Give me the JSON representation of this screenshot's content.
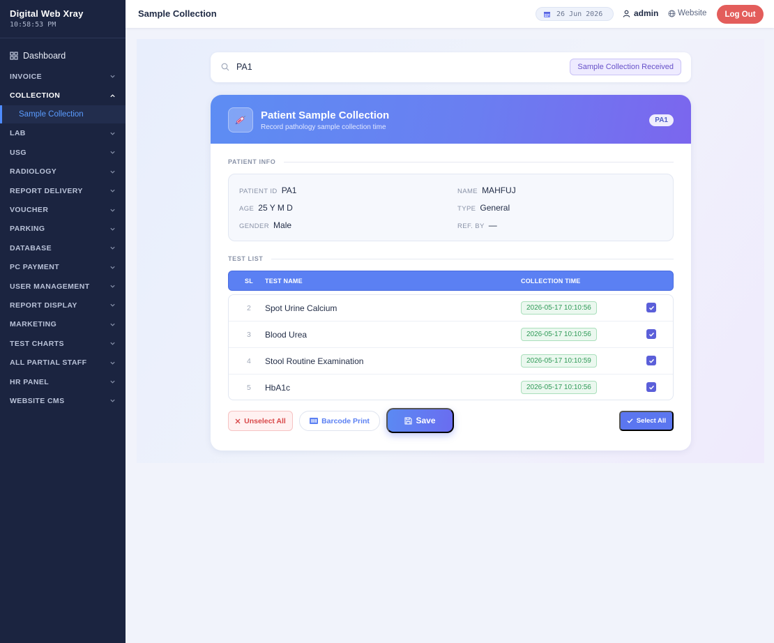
{
  "sidebar": {
    "brand": "Digital Web Xray",
    "clock": "10:58:53 PM",
    "dashboard": "Dashboard",
    "items": [
      {
        "label": "INVOICE"
      },
      {
        "label": "COLLECTION"
      },
      {
        "label": "LAB"
      },
      {
        "label": "USG"
      },
      {
        "label": "RADIOLOGY"
      },
      {
        "label": "REPORT DELIVERY"
      },
      {
        "label": "VOUCHER"
      },
      {
        "label": "PARKING"
      },
      {
        "label": "DATABASE"
      },
      {
        "label": "PC PAYMENT"
      },
      {
        "label": "USER MANAGEMENT"
      },
      {
        "label": "REPORT DISPLAY"
      },
      {
        "label": "MARKETING"
      },
      {
        "label": "TEST CHARTS"
      },
      {
        "label": "ALL PARTIAL STAFF"
      },
      {
        "label": "HR PANEL"
      },
      {
        "label": "WEBSITE CMS"
      }
    ],
    "sub_item": "Sample Collection"
  },
  "topbar": {
    "title": "Sample Collection",
    "date": "26 Jun 2026",
    "user": "admin",
    "website": "Website",
    "logout": "Log Out"
  },
  "search": {
    "value": "PA1",
    "status": "Sample Collection Received"
  },
  "card": {
    "title": "Patient Sample Collection",
    "subtitle": "Record pathology sample collection time",
    "badge": "PA1"
  },
  "patient_info": {
    "section_label": "PATIENT INFO",
    "patient_id_label": "PATIENT ID",
    "patient_id": "PA1",
    "name_label": "NAME",
    "name": "MAHFUJ",
    "age_label": "AGE",
    "age": "25 Y M D",
    "type_label": "TYPE",
    "type": "General",
    "gender_label": "GENDER",
    "gender": "Male",
    "ref_label": "REF. BY",
    "ref": "—"
  },
  "tests": {
    "section_label": "TEST LIST",
    "headers": {
      "sl": "SL",
      "name": "TEST NAME",
      "time": "COLLECTION TIME"
    },
    "rows": [
      {
        "sl": "2",
        "name": "Spot Urine Calcium",
        "time": "2026-05-17 10:10:56"
      },
      {
        "sl": "3",
        "name": "Blood Urea",
        "time": "2026-05-17 10:10:56"
      },
      {
        "sl": "4",
        "name": "Stool Routine Examination",
        "time": "2026-05-17 10:10:59"
      },
      {
        "sl": "5",
        "name": "HbA1c",
        "time": "2026-05-17 10:10:56"
      }
    ]
  },
  "actions": {
    "unselect_all": "Unselect All",
    "barcode_print": "Barcode Print",
    "save": "Save",
    "select_all": "Select All"
  },
  "colors": {
    "sidebar_bg": "#1b2440",
    "accent": "#5b80f3",
    "logout": "#e35d5b",
    "success": "#2f9a57"
  }
}
